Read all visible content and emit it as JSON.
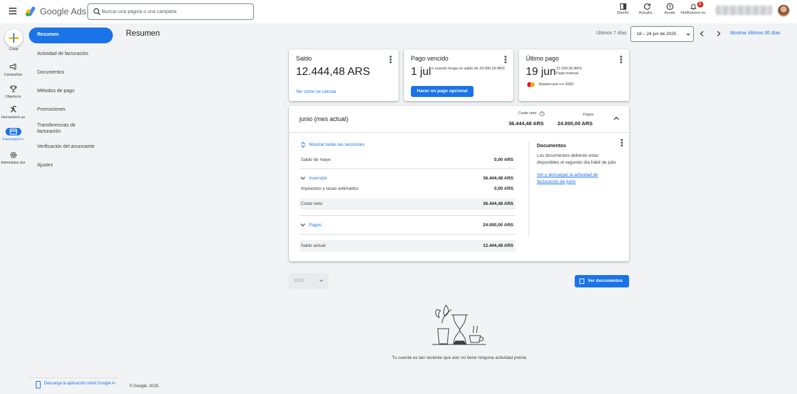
{
  "header": {
    "brand": "Google Ads",
    "search_placeholder": "Buscar una página o una campaña",
    "tools": [
      {
        "label": "Diseño",
        "icon": "appearance-icon"
      },
      {
        "label": "Actualiz...",
        "icon": "refresh-icon"
      },
      {
        "label": "Ayuda",
        "icon": "help-icon"
      },
      {
        "label": "Notificacion es",
        "icon": "bell-icon",
        "badge": "1"
      }
    ]
  },
  "rail": {
    "create": "Crear",
    "items": [
      {
        "label": "Campañas",
        "icon": "megaphone-icon"
      },
      {
        "label": "Objetivos",
        "icon": "trophy-icon"
      },
      {
        "label": "Herramient as",
        "icon": "tools-icon"
      },
      {
        "label": "Facturació n",
        "icon": "billing-icon",
        "active": true
      },
      {
        "label": "Administra dor",
        "icon": "admin-gear-icon"
      }
    ]
  },
  "sidebar": {
    "items": [
      {
        "label": "Resumen",
        "active": true
      },
      {
        "label": "Actividad de facturación"
      },
      {
        "label": "Documentos"
      },
      {
        "label": "Métodos de pago"
      },
      {
        "label": "Promociones"
      },
      {
        "label": "Transferencias de facturación"
      },
      {
        "label": "Verificación del anunciante"
      },
      {
        "label": "Ajustes"
      }
    ],
    "download_app": "Descarga la aplicación móvil Google A›"
  },
  "footer": {
    "copyright": "© Google, 2025."
  },
  "page": {
    "title": "Resumen",
    "range_label": "Últimos 7 días",
    "date_range": "18 – 24 jun de 2025",
    "show_30": "Mostrar últimos 30 días"
  },
  "cards": {
    "saldo": {
      "title": "Saldo",
      "amount": "12.444,48 ARS",
      "link": "Ver cómo se calcula"
    },
    "vencido": {
      "title": "Pago vencido",
      "date": "1 jul",
      "note": "o cuando tenga un saldo de 20.000,00 ARS",
      "button": "Hacer un pago opcional"
    },
    "ultimo": {
      "title": "Último pago",
      "date": "19 jun",
      "amount": "12.000,00 ARS",
      "method": "Pago manual",
      "card": "Mastercard •••• 3083"
    }
  },
  "month": {
    "title": "junio (mes actual)",
    "net_label": "Coste neto",
    "net_value": "36.444,48 ARS",
    "pay_label": "Pagos",
    "pay_value": "24.000,00 ARS",
    "show_all": "Mostrar todas las secciones",
    "rows": {
      "saldo_mayo": {
        "label": "Saldo de mayo",
        "value": "0,00 ARS"
      },
      "inversion": {
        "label": "Inversión",
        "value": "36.444,48 ARS"
      },
      "impuestos": {
        "label": "Impuestos y tasas estimados",
        "value": "0,00 ARS"
      },
      "coste_neto": {
        "label": "Coste neto",
        "value": "36.444,48 ARS"
      },
      "pagos": {
        "label": "Pagos",
        "value": "24.000,00 ARS"
      },
      "saldo_actual": {
        "label": "Saldo actual",
        "value": "12.444,48 ARS"
      }
    },
    "docs": {
      "title": "Documentos",
      "text": "Los documentos deberán estar disponibles el segundo día hábil de julio",
      "link": "Ver y descargar la actividad de facturación de junio"
    }
  },
  "bottom": {
    "year": "2025",
    "docs_button": "Ver documentos",
    "empty_message": "Tu cuenta es tan reciente que aún no tiene ninguna actividad previa"
  },
  "colors": {
    "accent": "#1a73e8",
    "background": "#f1f3f4",
    "badge": "#d93025"
  }
}
